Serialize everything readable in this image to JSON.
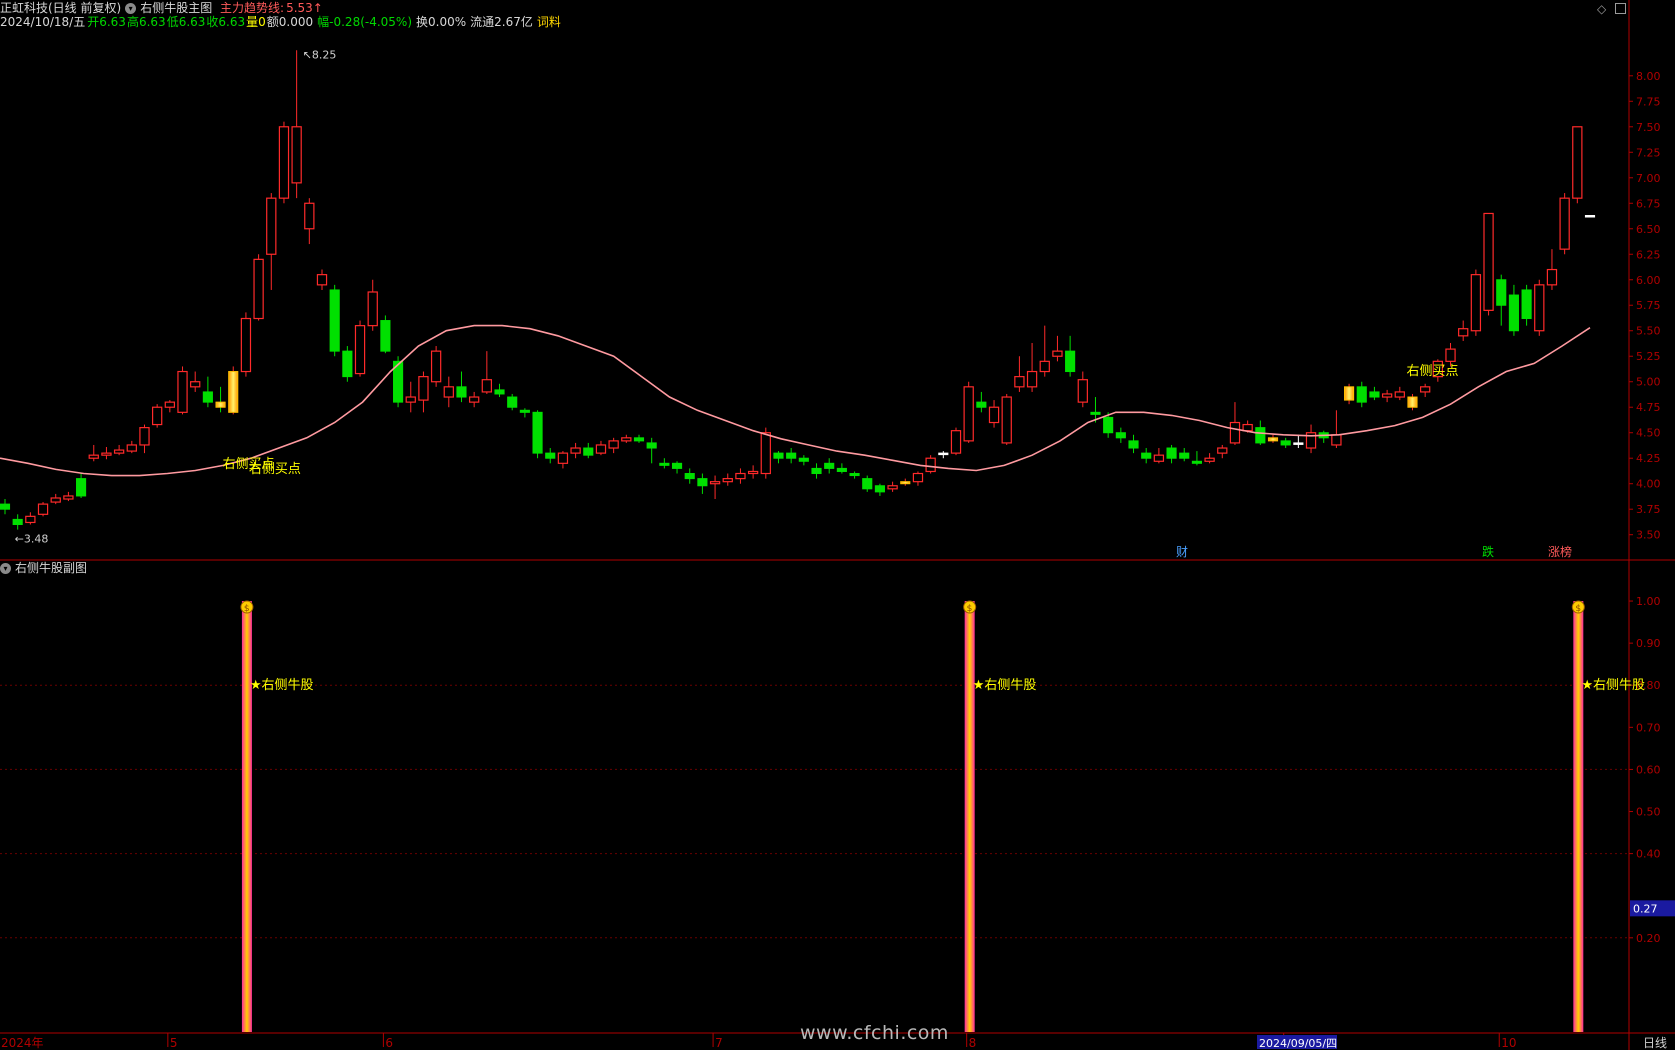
{
  "header": {
    "stock_name": "正虹科技(日线 前复权)",
    "indicator_name": "右侧牛股主图",
    "trend_label": "主力趋势线:",
    "trend_value": "5.53↑",
    "date": "2024/10/18/五",
    "open": "开6.63",
    "high": "高6.63",
    "low": "低6.63",
    "close": "收6.63",
    "volume": "量0",
    "amount": "额0.000",
    "change": "幅-0.28(-4.05%)",
    "turnover": "换0.00%",
    "float_cap": "流通2.67亿",
    "info_link": "词料"
  },
  "sub_header": {
    "indicator_name": "右侧牛股副图"
  },
  "x_axis": {
    "year_label": "2024年",
    "month_labels": [
      "5",
      "6",
      "7",
      "8",
      "9",
      "10"
    ],
    "highlight_date": "2024/09/05/四",
    "period": "日线"
  },
  "watermark": "www.cfchi.com",
  "colors": {
    "up": "#ff2a2a",
    "down": "#00e000",
    "flat": "#ffffff",
    "trend_line": "#ff9aa0",
    "gold": "#ffc000",
    "signal_pink": "#ff2aa0",
    "label_yellow": "#ffff00",
    "axis_red": "#b00000"
  },
  "chart_data": [
    {
      "type": "candlestick",
      "title": "右侧牛股主图",
      "ylim": [
        3.35,
        8.4
      ],
      "y_ticks": [
        "3.50",
        "3.75",
        "4.00",
        "4.25",
        "4.50",
        "4.75",
        "5.00",
        "5.25",
        "5.50",
        "5.75",
        "6.00",
        "6.25",
        "6.50",
        "6.75",
        "7.00",
        "7.25",
        "7.50",
        "7.75",
        "8.00"
      ],
      "candles": [
        [
          3.8,
          3.75,
          3.85,
          3.7
        ],
        [
          3.65,
          3.6,
          3.7,
          3.55
        ],
        [
          3.62,
          3.68,
          3.72,
          3.6
        ],
        [
          3.7,
          3.8,
          3.82,
          3.68
        ],
        [
          3.82,
          3.86,
          3.9,
          3.8
        ],
        [
          3.85,
          3.88,
          3.92,
          3.83
        ],
        [
          4.05,
          3.88,
          4.1,
          3.86
        ],
        [
          4.25,
          4.28,
          4.38,
          4.22
        ],
        [
          4.28,
          4.3,
          4.36,
          4.24
        ],
        [
          4.3,
          4.33,
          4.38,
          4.28
        ],
        [
          4.32,
          4.38,
          4.42,
          4.3
        ],
        [
          4.38,
          4.55,
          4.58,
          4.3
        ],
        [
          4.58,
          4.75,
          4.78,
          4.55
        ],
        [
          4.75,
          4.8,
          4.82,
          4.7
        ],
        [
          4.7,
          5.1,
          5.15,
          4.68
        ],
        [
          4.95,
          5.0,
          5.1,
          4.9
        ],
        [
          4.9,
          4.8,
          5.05,
          4.75
        ],
        [
          4.8,
          4.75,
          4.95,
          4.7
        ],
        [
          4.7,
          5.1,
          5.15,
          4.68
        ],
        [
          5.1,
          5.62,
          5.68,
          5.05
        ],
        [
          5.62,
          6.2,
          6.25,
          5.6
        ],
        [
          6.25,
          6.8,
          6.85,
          5.9
        ],
        [
          6.8,
          7.5,
          7.55,
          6.75
        ],
        [
          6.95,
          7.5,
          8.25,
          6.8
        ],
        [
          6.5,
          6.75,
          6.8,
          6.35
        ],
        [
          5.95,
          6.05,
          6.1,
          5.9
        ],
        [
          5.9,
          5.3,
          5.95,
          5.25
        ],
        [
          5.3,
          5.05,
          5.35,
          5.0
        ],
        [
          5.08,
          5.55,
          5.6,
          5.05
        ],
        [
          5.55,
          5.88,
          6.0,
          5.5
        ],
        [
          5.6,
          5.3,
          5.65,
          5.28
        ],
        [
          5.2,
          4.8,
          5.25,
          4.75
        ],
        [
          4.8,
          4.85,
          5.0,
          4.7
        ],
        [
          4.82,
          5.05,
          5.1,
          4.7
        ],
        [
          5.0,
          5.3,
          5.35,
          4.95
        ],
        [
          4.85,
          4.95,
          5.05,
          4.75
        ],
        [
          4.95,
          4.85,
          5.1,
          4.8
        ],
        [
          4.8,
          4.85,
          4.9,
          4.75
        ],
        [
          4.9,
          5.02,
          5.3,
          4.88
        ],
        [
          4.92,
          4.88,
          4.98,
          4.85
        ],
        [
          4.85,
          4.75,
          4.88,
          4.72
        ],
        [
          4.72,
          4.7,
          4.74,
          4.65
        ],
        [
          4.7,
          4.3,
          4.72,
          4.25
        ],
        [
          4.3,
          4.25,
          4.35,
          4.2
        ],
        [
          4.2,
          4.3,
          4.32,
          4.15
        ],
        [
          4.3,
          4.35,
          4.4,
          4.25
        ],
        [
          4.35,
          4.28,
          4.4,
          4.25
        ],
        [
          4.3,
          4.38,
          4.42,
          4.28
        ],
        [
          4.35,
          4.42,
          4.45,
          4.3
        ],
        [
          4.42,
          4.45,
          4.48,
          4.4
        ],
        [
          4.45,
          4.42,
          4.48,
          4.4
        ],
        [
          4.4,
          4.35,
          4.45,
          4.2
        ],
        [
          4.2,
          4.18,
          4.25,
          4.15
        ],
        [
          4.2,
          4.15,
          4.22,
          4.1
        ],
        [
          4.1,
          4.05,
          4.15,
          4.0
        ],
        [
          4.05,
          3.98,
          4.1,
          3.9
        ],
        [
          4.0,
          4.02,
          4.08,
          3.85
        ],
        [
          4.02,
          4.05,
          4.1,
          3.98
        ],
        [
          4.05,
          4.1,
          4.15,
          4.0
        ],
        [
          4.1,
          4.12,
          4.18,
          4.05
        ],
        [
          4.1,
          4.5,
          4.55,
          4.05
        ],
        [
          4.3,
          4.25,
          4.32,
          4.2
        ],
        [
          4.3,
          4.25,
          4.35,
          4.2
        ],
        [
          4.25,
          4.22,
          4.28,
          4.18
        ],
        [
          4.15,
          4.1,
          4.2,
          4.05
        ],
        [
          4.2,
          4.15,
          4.25,
          4.1
        ],
        [
          4.15,
          4.12,
          4.2,
          4.1
        ],
        [
          4.1,
          4.08,
          4.12,
          4.05
        ],
        [
          4.05,
          3.95,
          4.08,
          3.92
        ],
        [
          3.98,
          3.92,
          4.0,
          3.88
        ],
        [
          3.95,
          3.98,
          4.02,
          3.92
        ],
        [
          4.0,
          4.02,
          4.05,
          3.98
        ],
        [
          4.02,
          4.1,
          4.12,
          3.98
        ],
        [
          4.12,
          4.25,
          4.28,
          4.1
        ],
        [
          4.3,
          4.3,
          4.32,
          4.25
        ],
        [
          4.3,
          4.52,
          4.55,
          4.28
        ],
        [
          4.42,
          4.95,
          5.0,
          4.4
        ],
        [
          4.8,
          4.75,
          4.9,
          4.7
        ],
        [
          4.6,
          4.75,
          4.82,
          4.55
        ],
        [
          4.4,
          4.85,
          4.88,
          4.38
        ],
        [
          4.95,
          5.05,
          5.25,
          4.9
        ],
        [
          4.95,
          5.1,
          5.38,
          4.9
        ],
        [
          5.1,
          5.2,
          5.55,
          5.05
        ],
        [
          5.25,
          5.3,
          5.45,
          5.2
        ],
        [
          5.3,
          5.1,
          5.45,
          5.05
        ],
        [
          4.8,
          5.02,
          5.1,
          4.75
        ],
        [
          4.7,
          4.68,
          4.85,
          4.6
        ],
        [
          4.65,
          4.5,
          4.7,
          4.45
        ],
        [
          4.5,
          4.45,
          4.55,
          4.4
        ],
        [
          4.42,
          4.35,
          4.48,
          4.3
        ],
        [
          4.3,
          4.25,
          4.35,
          4.2
        ],
        [
          4.22,
          4.28,
          4.35,
          4.2
        ],
        [
          4.35,
          4.25,
          4.38,
          4.2
        ],
        [
          4.3,
          4.25,
          4.35,
          4.22
        ],
        [
          4.22,
          4.2,
          4.32,
          4.18
        ],
        [
          4.22,
          4.25,
          4.3,
          4.2
        ],
        [
          4.3,
          4.35,
          4.38,
          4.25
        ],
        [
          4.4,
          4.6,
          4.8,
          4.38
        ],
        [
          4.52,
          4.58,
          4.62,
          4.5
        ],
        [
          4.55,
          4.4,
          4.62,
          4.38
        ],
        [
          4.42,
          4.45,
          4.48,
          4.4
        ],
        [
          4.42,
          4.38,
          4.45,
          4.35
        ],
        [
          4.4,
          4.4,
          4.48,
          4.35
        ],
        [
          4.35,
          4.5,
          4.58,
          4.3
        ],
        [
          4.5,
          4.45,
          4.52,
          4.4
        ],
        [
          4.38,
          4.48,
          4.72,
          4.35
        ],
        [
          4.82,
          4.95,
          4.98,
          4.78
        ],
        [
          4.95,
          4.8,
          5.0,
          4.75
        ],
        [
          4.9,
          4.85,
          4.95,
          4.82
        ],
        [
          4.85,
          4.88,
          4.92,
          4.8
        ],
        [
          4.85,
          4.9,
          4.95,
          4.82
        ],
        [
          4.75,
          4.85,
          4.88,
          4.72
        ],
        [
          4.9,
          4.95,
          4.98,
          4.85
        ],
        [
          5.05,
          5.2,
          5.22,
          5.0
        ],
        [
          5.2,
          5.32,
          5.38,
          5.15
        ],
        [
          5.45,
          5.52,
          5.6,
          5.4
        ],
        [
          5.5,
          6.05,
          6.1,
          5.45
        ],
        [
          5.7,
          6.65,
          6.65,
          5.65
        ],
        [
          6.0,
          5.75,
          6.05,
          5.55
        ],
        [
          5.85,
          5.5,
          5.95,
          5.45
        ],
        [
          5.9,
          5.62,
          5.95,
          5.55
        ],
        [
          5.5,
          5.95,
          6.0,
          5.45
        ],
        [
          5.95,
          6.1,
          6.3,
          5.9
        ],
        [
          6.3,
          6.8,
          6.85,
          6.25
        ],
        [
          6.8,
          7.5,
          7.5,
          6.75
        ],
        [
          6.63,
          6.63,
          6.63,
          6.63
        ]
      ],
      "trend_line": [
        4.25,
        4.2,
        4.14,
        4.1,
        4.08,
        4.08,
        4.1,
        4.13,
        4.18,
        4.25,
        4.35,
        4.45,
        4.6,
        4.8,
        5.1,
        5.35,
        5.5,
        5.55,
        5.55,
        5.52,
        5.45,
        5.35,
        5.25,
        5.05,
        4.85,
        4.72,
        4.62,
        4.52,
        4.44,
        4.38,
        4.32,
        4.28,
        4.23,
        4.18,
        4.15,
        4.13,
        4.18,
        4.28,
        4.42,
        4.6,
        4.7,
        4.7,
        4.67,
        4.62,
        4.55,
        4.5,
        4.48,
        4.47,
        4.48,
        4.52,
        4.57,
        4.65,
        4.78,
        4.95,
        5.1,
        5.18,
        5.35,
        5.53
      ],
      "gold_candles": [
        17,
        18,
        71,
        100,
        106,
        111
      ],
      "annotations": [
        {
          "label": "右侧买点",
          "at": "2024-05 (first)"
        },
        {
          "label": "右侧买点",
          "at": "2024-05 (second)"
        },
        {
          "label": "右侧买点",
          "at": "2024-10"
        }
      ],
      "price_marks": [
        {
          "label": "8.25"
        },
        {
          "label": "3.48"
        }
      ],
      "bottom_tags": [
        "财",
        "跌",
        "涨榜"
      ]
    },
    {
      "type": "bar",
      "title": "右侧牛股副图",
      "ylim": [
        0,
        1.05
      ],
      "y_ticks": [
        "0.20",
        "0.40",
        "0.50",
        "0.60",
        "0.70",
        "0.80",
        "0.90",
        "1.00"
      ],
      "current_value": "0.27",
      "signals": [
        {
          "value": 1.0,
          "label": "★右侧牛股"
        },
        {
          "value": 1.0,
          "label": "★右侧牛股"
        },
        {
          "value": 1.0,
          "label": "★右侧牛股"
        }
      ]
    }
  ]
}
